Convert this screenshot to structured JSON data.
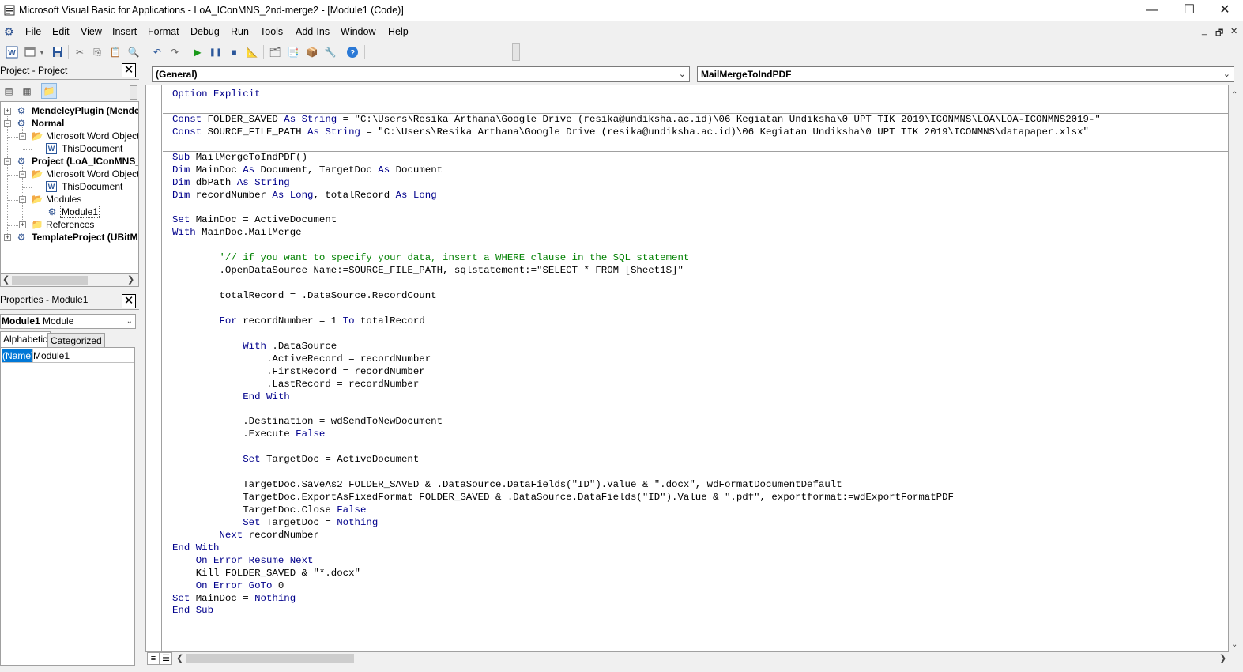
{
  "window": {
    "title": "Microsoft Visual Basic for Applications - LoA_IConMNS_2nd-merge2 - [Module1 (Code)]",
    "icon": "vba-app-icon",
    "controls": {
      "minimize": "—",
      "maximize": "☐",
      "close": "✕"
    }
  },
  "menubar": {
    "items": [
      {
        "pre": "",
        "ul": "F",
        "post": "ile"
      },
      {
        "pre": "",
        "ul": "E",
        "post": "dit"
      },
      {
        "pre": "",
        "ul": "V",
        "post": "iew"
      },
      {
        "pre": "",
        "ul": "I",
        "post": "nsert"
      },
      {
        "pre": "F",
        "ul": "o",
        "post": "rmat"
      },
      {
        "pre": "",
        "ul": "D",
        "post": "ebug"
      },
      {
        "pre": "",
        "ul": "R",
        "post": "un"
      },
      {
        "pre": "",
        "ul": "T",
        "post": "ools"
      },
      {
        "pre": "",
        "ul": "A",
        "post": "dd-Ins"
      },
      {
        "pre": "",
        "ul": "W",
        "post": "indow"
      },
      {
        "pre": "",
        "ul": "H",
        "post": "elp"
      }
    ],
    "mdi": {
      "minimize": "_",
      "restore": "🗗",
      "close": "✕"
    }
  },
  "project_pane": {
    "title": "Project - Project",
    "close": "✕",
    "tree": {
      "n1": "MendeleyPlugin (Mende",
      "n2": "Normal",
      "n3": "Microsoft Word Objects",
      "n4": "ThisDocument",
      "n5": "Project (LoA_IConMNS_",
      "n6": "Microsoft Word Objects",
      "n7": "ThisDocument",
      "n8": "Modules",
      "n9": "Module1",
      "n10": "References",
      "n11": "TemplateProject (UBitM"
    }
  },
  "properties_pane": {
    "title": "Properties - Module1",
    "close": "✕",
    "object_name": "Module1",
    "object_type": "Module",
    "tabs": [
      "Alphabetic",
      "Categorized"
    ],
    "prop_name": "(Name)",
    "prop_value": "Module1"
  },
  "editor": {
    "object_combo": "(General)",
    "proc_combo": "MailMergeToIndPDF",
    "code_lines": [
      [
        [
          "kw",
          "Option Explicit"
        ]
      ],
      [],
      [
        [
          "kw",
          "Const"
        ],
        [
          "n",
          " FOLDER_SAVED "
        ],
        [
          "kw",
          "As String"
        ],
        [
          "n",
          " = \"C:\\Users\\Resika Arthana\\Google Drive (resika@undiksha.ac.id)\\06 Kegiatan Undiksha\\0 UPT TIK 2019\\ICONMNS\\LOA\\LOA-ICONMNS2019-\""
        ]
      ],
      [
        [
          "kw",
          "Const"
        ],
        [
          "n",
          " SOURCE_FILE_PATH "
        ],
        [
          "kw",
          "As String"
        ],
        [
          "n",
          " = \"C:\\Users\\Resika Arthana\\Google Drive (resika@undiksha.ac.id)\\06 Kegiatan Undiksha\\0 UPT TIK 2019\\ICONMNS\\datapaper.xlsx\""
        ]
      ],
      [],
      [
        [
          "kw",
          "Sub"
        ],
        [
          "n",
          " MailMergeToIndPDF()"
        ]
      ],
      [
        [
          "kw",
          "Dim"
        ],
        [
          "n",
          " MainDoc "
        ],
        [
          "kw",
          "As"
        ],
        [
          "n",
          " Document, TargetDoc "
        ],
        [
          "kw",
          "As"
        ],
        [
          "n",
          " Document"
        ]
      ],
      [
        [
          "kw",
          "Dim"
        ],
        [
          "n",
          " dbPath "
        ],
        [
          "kw",
          "As String"
        ]
      ],
      [
        [
          "kw",
          "Dim"
        ],
        [
          "n",
          " recordNumber "
        ],
        [
          "kw",
          "As Long"
        ],
        [
          "n",
          ", totalRecord "
        ],
        [
          "kw",
          "As Long"
        ]
      ],
      [],
      [
        [
          "kw",
          "Set"
        ],
        [
          "n",
          " MainDoc = ActiveDocument"
        ]
      ],
      [
        [
          "kw",
          "With"
        ],
        [
          "n",
          " MainDoc.MailMerge"
        ]
      ],
      [],
      [
        [
          "n",
          "        "
        ],
        [
          "cm",
          "'// if you want to specify your data, insert a WHERE clause in the SQL statement"
        ]
      ],
      [
        [
          "n",
          "        .OpenDataSource Name:=SOURCE_FILE_PATH, sqlstatement:=\"SELECT * FROM [Sheet1$]\""
        ]
      ],
      [],
      [
        [
          "n",
          "        totalRecord = .DataSource.RecordCount"
        ]
      ],
      [],
      [
        [
          "n",
          "        "
        ],
        [
          "kw",
          "For"
        ],
        [
          "n",
          " recordNumber = 1 "
        ],
        [
          "kw",
          "To"
        ],
        [
          "n",
          " totalRecord"
        ]
      ],
      [],
      [
        [
          "n",
          "            "
        ],
        [
          "kw",
          "With"
        ],
        [
          "n",
          " .DataSource"
        ]
      ],
      [
        [
          "n",
          "                .ActiveRecord = recordNumber"
        ]
      ],
      [
        [
          "n",
          "                .FirstRecord = recordNumber"
        ]
      ],
      [
        [
          "n",
          "                .LastRecord = recordNumber"
        ]
      ],
      [
        [
          "n",
          "            "
        ],
        [
          "kw",
          "End With"
        ]
      ],
      [],
      [
        [
          "n",
          "            .Destination = wdSendToNewDocument"
        ]
      ],
      [
        [
          "n",
          "            .Execute "
        ],
        [
          "kw",
          "False"
        ]
      ],
      [],
      [
        [
          "n",
          "            "
        ],
        [
          "kw",
          "Set"
        ],
        [
          "n",
          " TargetDoc = ActiveDocument"
        ]
      ],
      [],
      [
        [
          "n",
          "            TargetDoc.SaveAs2 FOLDER_SAVED & .DataSource.DataFields(\"ID\").Value & \".docx\", wdFormatDocumentDefault"
        ]
      ],
      [
        [
          "n",
          "            TargetDoc.ExportAsFixedFormat FOLDER_SAVED & .DataSource.DataFields(\"ID\").Value & \".pdf\", exportformat:=wdExportFormatPDF"
        ]
      ],
      [
        [
          "n",
          "            TargetDoc.Close "
        ],
        [
          "kw",
          "False"
        ]
      ],
      [
        [
          "n",
          "            "
        ],
        [
          "kw",
          "Set"
        ],
        [
          "n",
          " TargetDoc = "
        ],
        [
          "kw",
          "Nothing"
        ]
      ],
      [
        [
          "n",
          "        "
        ],
        [
          "kw",
          "Next"
        ],
        [
          "n",
          " recordNumber"
        ]
      ],
      [
        [
          "kw",
          "End With"
        ]
      ],
      [
        [
          "n",
          "    "
        ],
        [
          "kw",
          "On Error Resume Next"
        ]
      ],
      [
        [
          "n",
          "    Kill FOLDER_SAVED & \"*.docx\""
        ]
      ],
      [
        [
          "n",
          "    "
        ],
        [
          "kw",
          "On Error GoTo"
        ],
        [
          "n",
          " 0"
        ]
      ],
      [
        [
          "kw",
          "Set"
        ],
        [
          "n",
          " MainDoc = "
        ],
        [
          "kw",
          "Nothing"
        ]
      ],
      [
        [
          "kw",
          "End Sub"
        ]
      ]
    ]
  },
  "colors": {
    "keyword": "#00008b",
    "comment": "#008000",
    "selection": "#0078d7"
  }
}
